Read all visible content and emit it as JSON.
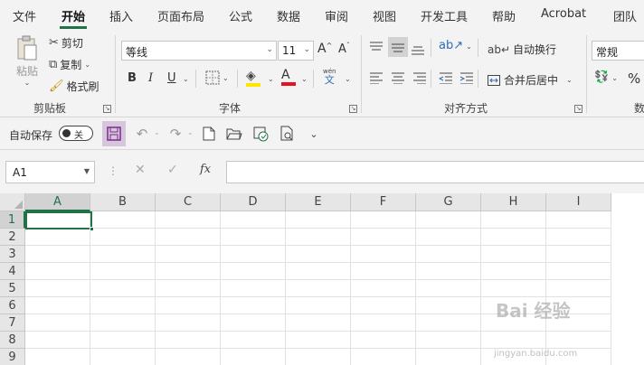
{
  "menu": {
    "tabs": [
      "文件",
      "开始",
      "插入",
      "页面布局",
      "公式",
      "数据",
      "审阅",
      "视图",
      "开发工具",
      "帮助",
      "Acrobat",
      "团队"
    ],
    "active_index": 1
  },
  "ribbon": {
    "clipboard": {
      "paste": "粘贴",
      "cut": "剪切",
      "copy": "复制",
      "format_painter": "格式刷",
      "group_label": "剪贴板"
    },
    "font": {
      "name": "等线",
      "size": "11",
      "bold": "B",
      "italic": "I",
      "underline": "U",
      "grow": "A",
      "shrink": "A",
      "phonetic_top": "wén",
      "phonetic_bottom": "文",
      "group_label": "字体"
    },
    "alignment": {
      "wrap_text": "自动换行",
      "merge_center": "合并后居中",
      "group_label": "对齐方式"
    },
    "number": {
      "format": "常规",
      "percent": "%",
      "group_label": "数"
    }
  },
  "qat": {
    "autosave_label": "自动保存",
    "autosave_state": "关"
  },
  "formula_bar": {
    "name_box": "A1",
    "dots": "⋮",
    "fx": "fx",
    "formula": ""
  },
  "grid": {
    "columns": [
      "A",
      "B",
      "C",
      "D",
      "E",
      "F",
      "G",
      "H",
      "I"
    ],
    "rows": [
      "1",
      "2",
      "3",
      "4",
      "5",
      "6",
      "7",
      "8",
      "9"
    ],
    "active_cell": "A1"
  },
  "watermark": {
    "text": "Bai 经验",
    "sub": "jingyan.baidu.com"
  },
  "colors": {
    "accent": "#217346",
    "highlight": "#ffe600",
    "font_color": "#e81123"
  }
}
